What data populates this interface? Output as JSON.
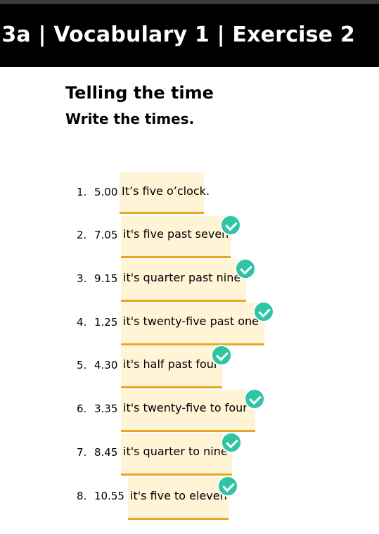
{
  "header": {
    "title": "3a | Vocabulary 1 | Exercise 2"
  },
  "exercise": {
    "title": "Telling the time",
    "instruction": "Write the times."
  },
  "items": [
    {
      "number": "1.",
      "time": "5.00",
      "answer": "It’s five o’clock.",
      "checked": false
    },
    {
      "number": "2.",
      "time": "7.05",
      "answer": "it's five past seven",
      "checked": true
    },
    {
      "number": "3.",
      "time": "9.15",
      "answer": "it's quarter past nine",
      "checked": true
    },
    {
      "number": "4.",
      "time": "1.25",
      "answer": "it's twenty-five past one",
      "checked": true
    },
    {
      "number": "5.",
      "time": "4.30",
      "answer": "it's half past four",
      "checked": true
    },
    {
      "number": "6.",
      "time": "3.35",
      "answer": "it's twenty-five to four",
      "checked": true
    },
    {
      "number": "7.",
      "time": "8.45",
      "answer": "it's quarter to nine",
      "checked": true
    },
    {
      "number": "8.",
      "time": "10.55",
      "answer": "it's five to eleven",
      "checked": true
    }
  ],
  "colors": {
    "header_bg": "#000000",
    "answer_bg": "#fff4d6",
    "answer_underline": "#e8a623",
    "check": "#2fc4a3"
  }
}
